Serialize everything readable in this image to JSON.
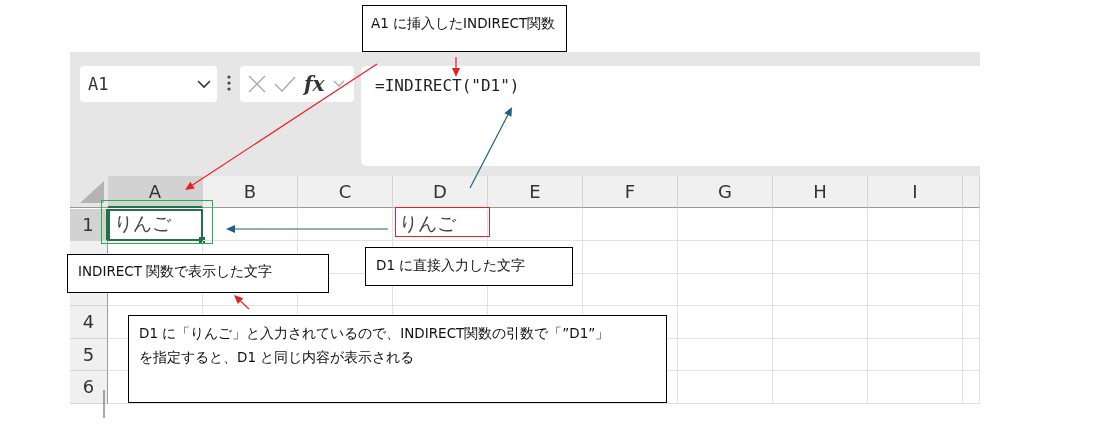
{
  "name_box": {
    "value": "A1"
  },
  "formula_bar": {
    "fx_label": "fx",
    "value": "=INDIRECT(\"D1\")"
  },
  "columns": [
    {
      "label": "A",
      "selected": true
    },
    {
      "label": "B",
      "selected": false
    },
    {
      "label": "C",
      "selected": false
    },
    {
      "label": "D",
      "selected": false
    },
    {
      "label": "E",
      "selected": false
    },
    {
      "label": "F",
      "selected": false
    },
    {
      "label": "G",
      "selected": false
    },
    {
      "label": "H",
      "selected": false
    },
    {
      "label": "I",
      "selected": false
    }
  ],
  "rows": [
    {
      "label": "1",
      "selected": true,
      "cells": [
        {
          "value": "りんご",
          "selected": true
        },
        {
          "selected": false
        },
        {
          "selected": false
        },
        {
          "value": "りんご",
          "selected": false
        }
      ]
    },
    {
      "selected": false
    },
    {
      "selected": false
    },
    {
      "label": "4",
      "selected": false
    },
    {
      "label": "5",
      "selected": false
    },
    {
      "label": "6",
      "selected": false
    }
  ],
  "annotations": [
    {
      "kind": "callout",
      "lines": [
        "A1 に挿入したINDIRECT関数"
      ]
    },
    {
      "kind": "callout",
      "lines": [
        "INDIRECT 関数で表示した文字"
      ]
    },
    {
      "kind": "callout",
      "lines": [
        "D1 に直接入力した文字"
      ]
    },
    {
      "kind": "callout",
      "lines": [
        "D1 に「りんご」と入力されているので、INDIRECT関数の引数で「”D1”」",
        "を指定すると、D1 と同じ内容が表示される"
      ]
    }
  ]
}
